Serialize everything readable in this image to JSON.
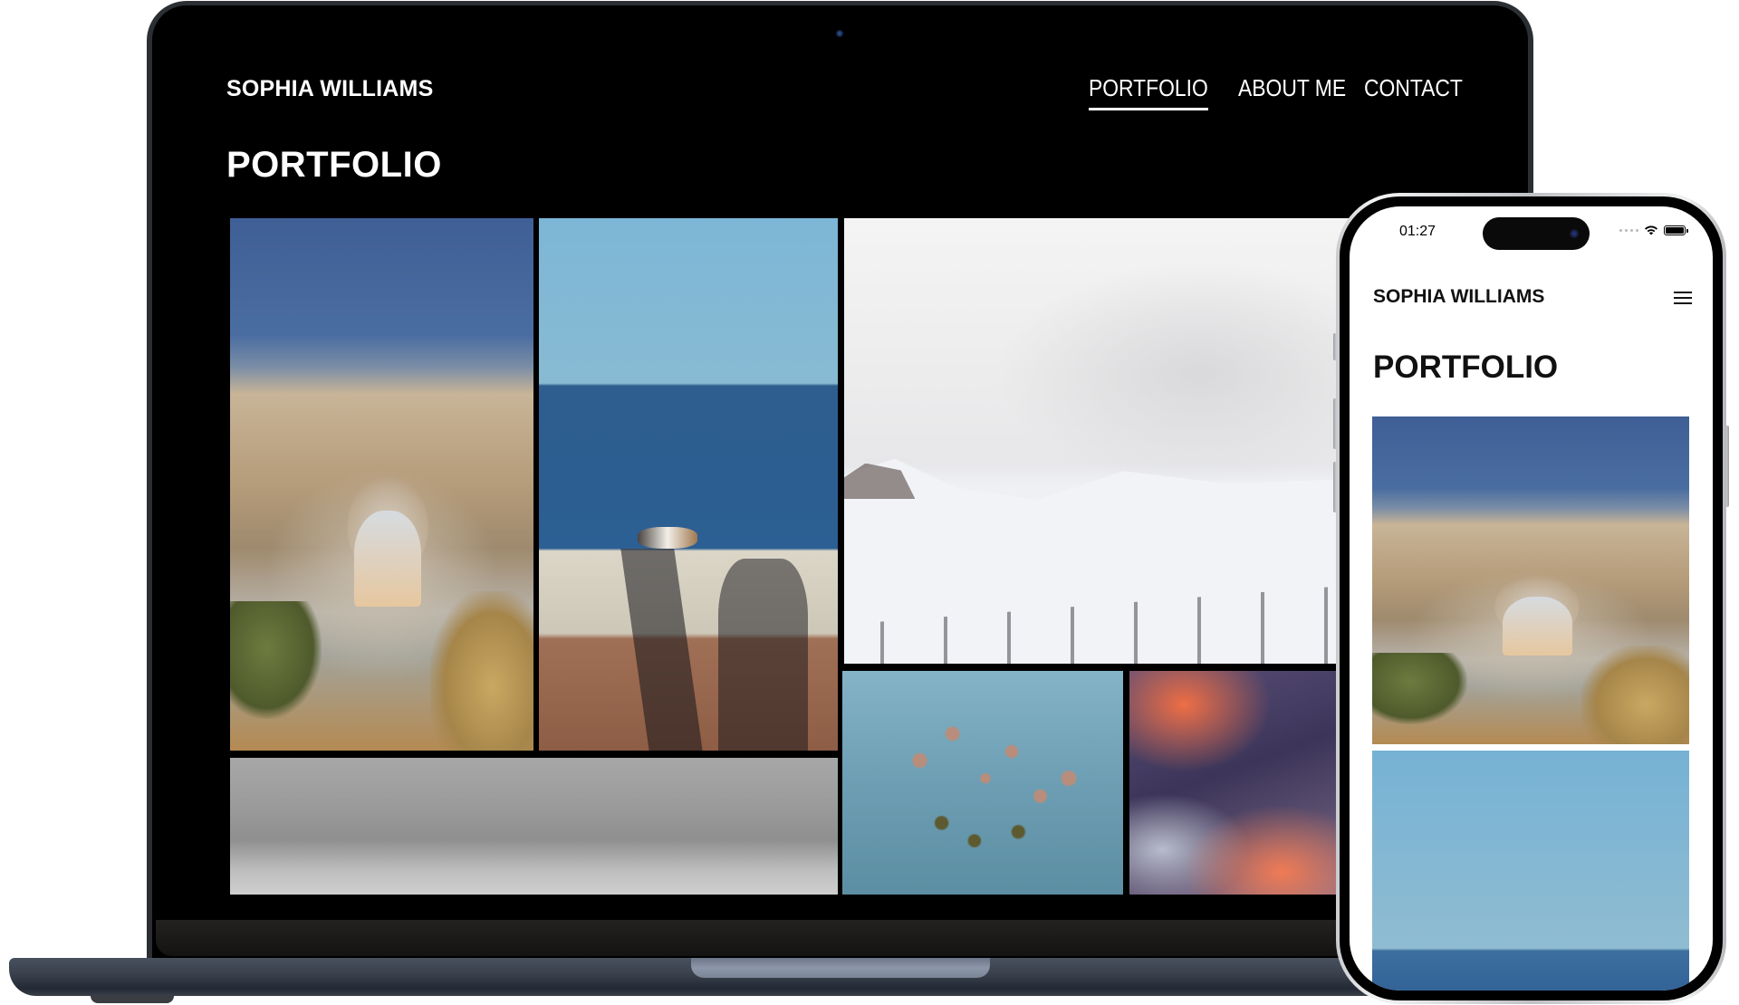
{
  "desktop": {
    "brand": "SOPHIA WILLIAMS",
    "nav": [
      {
        "label": "PORTFOLIO",
        "active": true
      },
      {
        "label": "ABOUT ME",
        "active": false
      },
      {
        "label": "CONTACT",
        "active": false
      }
    ],
    "page_title": "PORTFOLIO",
    "gallery": [
      {
        "name": "desert-arch-photo",
        "alt": "Person standing in a sandstone rock arch"
      },
      {
        "name": "sea-cat-photo",
        "alt": "Cat lying on a seawall with shadows"
      },
      {
        "name": "snowy-mountains-photo",
        "alt": "Snowy mountains under clouds"
      },
      {
        "name": "gray-fog-photo",
        "alt": "Gray foggy landscape"
      },
      {
        "name": "flower-water-photo",
        "alt": "Dried flower stems on water"
      },
      {
        "name": "sunset-clouds-photo",
        "alt": "Orange and purple sunset clouds"
      }
    ]
  },
  "mobile": {
    "status_time": "01:27",
    "brand": "SOPHIA WILLIAMS",
    "menu_icon": "hamburger-menu-icon",
    "page_title": "PORTFOLIO",
    "gallery": [
      {
        "name": "desert-arch-photo",
        "alt": "Person standing in a sandstone rock arch"
      },
      {
        "name": "sea-photo",
        "alt": "Blue sky over the sea"
      }
    ]
  },
  "colors": {
    "desktop_background": "#000000",
    "desktop_text": "#ffffff",
    "mobile_background": "#ffffff",
    "mobile_text": "#111111"
  }
}
